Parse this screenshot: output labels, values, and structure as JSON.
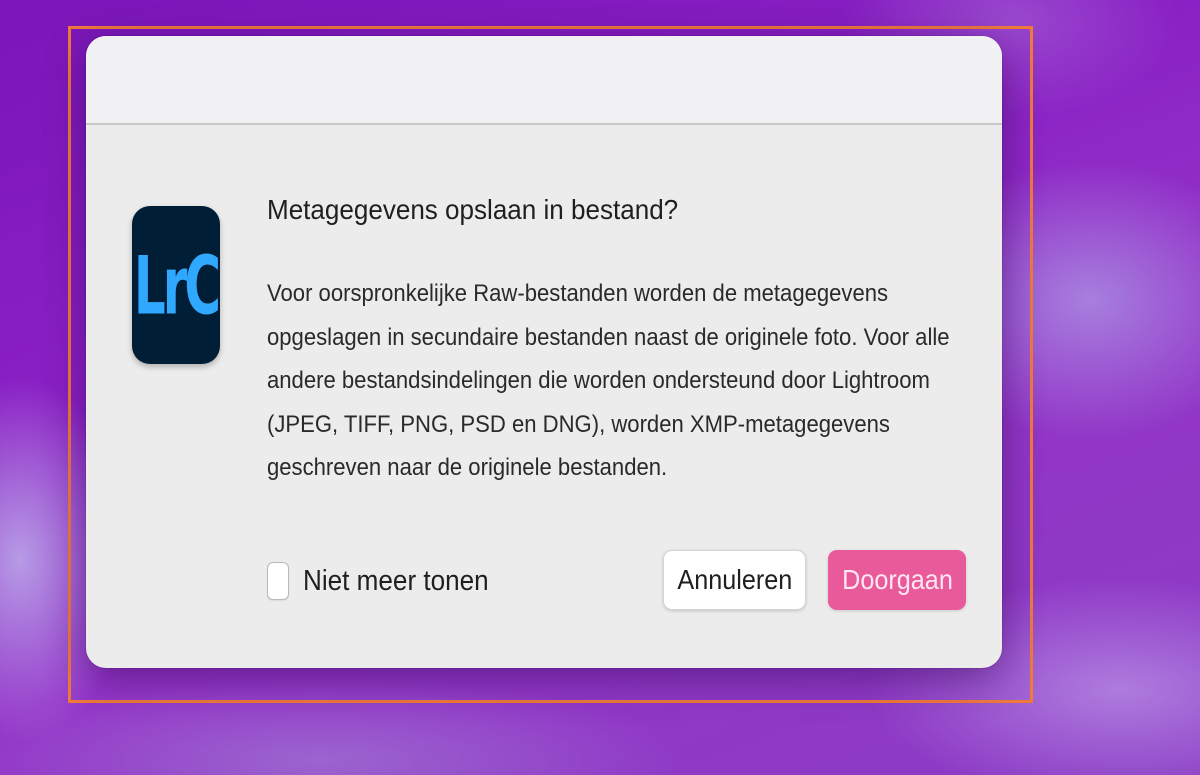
{
  "dialog": {
    "app_icon": {
      "icon": "lightroom-classic-icon",
      "text": "LrC",
      "tile_color": "#001e36",
      "glyph_color": "#31a8ff"
    },
    "title": "Metagegevens opslaan in bestand?",
    "message": "Voor oorspronkelijke Raw-bestanden worden de metagegevens opgeslagen in secundaire bestanden naast de originele foto. Voor alle andere bestandsindelingen die worden ondersteund door Lightroom (JPEG, TIFF, PNG, PSD en DNG), worden XMP-metagegevens geschreven naar de originele bestanden.",
    "checkbox": {
      "label": "Niet meer tonen",
      "checked": false
    },
    "buttons": {
      "cancel_label": "Annuleren",
      "continue_label": "Doorgaan"
    }
  },
  "colors": {
    "highlight_frame": "#f07a3a",
    "primary_button": "#e85a9a",
    "dialog_background": "#ececec"
  }
}
